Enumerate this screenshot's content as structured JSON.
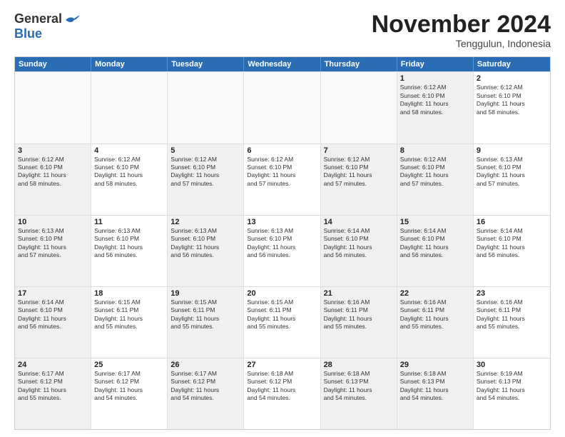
{
  "header": {
    "logo_line1": "General",
    "logo_line2": "Blue",
    "month_title": "November 2024",
    "subtitle": "Tenggulun, Indonesia"
  },
  "weekdays": [
    "Sunday",
    "Monday",
    "Tuesday",
    "Wednesday",
    "Thursday",
    "Friday",
    "Saturday"
  ],
  "rows": [
    [
      {
        "day": "",
        "info": "",
        "empty": true
      },
      {
        "day": "",
        "info": "",
        "empty": true
      },
      {
        "day": "",
        "info": "",
        "empty": true
      },
      {
        "day": "",
        "info": "",
        "empty": true
      },
      {
        "day": "",
        "info": "",
        "empty": true
      },
      {
        "day": "1",
        "info": "Sunrise: 6:12 AM\nSunset: 6:10 PM\nDaylight: 11 hours\nand 58 minutes.",
        "shaded": true
      },
      {
        "day": "2",
        "info": "Sunrise: 6:12 AM\nSunset: 6:10 PM\nDaylight: 11 hours\nand 58 minutes.",
        "shaded": false
      }
    ],
    [
      {
        "day": "3",
        "info": "Sunrise: 6:12 AM\nSunset: 6:10 PM\nDaylight: 11 hours\nand 58 minutes.",
        "shaded": true
      },
      {
        "day": "4",
        "info": "Sunrise: 6:12 AM\nSunset: 6:10 PM\nDaylight: 11 hours\nand 58 minutes.",
        "shaded": false
      },
      {
        "day": "5",
        "info": "Sunrise: 6:12 AM\nSunset: 6:10 PM\nDaylight: 11 hours\nand 57 minutes.",
        "shaded": true
      },
      {
        "day": "6",
        "info": "Sunrise: 6:12 AM\nSunset: 6:10 PM\nDaylight: 11 hours\nand 57 minutes.",
        "shaded": false
      },
      {
        "day": "7",
        "info": "Sunrise: 6:12 AM\nSunset: 6:10 PM\nDaylight: 11 hours\nand 57 minutes.",
        "shaded": true
      },
      {
        "day": "8",
        "info": "Sunrise: 6:12 AM\nSunset: 6:10 PM\nDaylight: 11 hours\nand 57 minutes.",
        "shaded": true
      },
      {
        "day": "9",
        "info": "Sunrise: 6:13 AM\nSunset: 6:10 PM\nDaylight: 11 hours\nand 57 minutes.",
        "shaded": false
      }
    ],
    [
      {
        "day": "10",
        "info": "Sunrise: 6:13 AM\nSunset: 6:10 PM\nDaylight: 11 hours\nand 57 minutes.",
        "shaded": true
      },
      {
        "day": "11",
        "info": "Sunrise: 6:13 AM\nSunset: 6:10 PM\nDaylight: 11 hours\nand 56 minutes.",
        "shaded": false
      },
      {
        "day": "12",
        "info": "Sunrise: 6:13 AM\nSunset: 6:10 PM\nDaylight: 11 hours\nand 56 minutes.",
        "shaded": true
      },
      {
        "day": "13",
        "info": "Sunrise: 6:13 AM\nSunset: 6:10 PM\nDaylight: 11 hours\nand 56 minutes.",
        "shaded": false
      },
      {
        "day": "14",
        "info": "Sunrise: 6:14 AM\nSunset: 6:10 PM\nDaylight: 11 hours\nand 56 minutes.",
        "shaded": true
      },
      {
        "day": "15",
        "info": "Sunrise: 6:14 AM\nSunset: 6:10 PM\nDaylight: 11 hours\nand 56 minutes.",
        "shaded": true
      },
      {
        "day": "16",
        "info": "Sunrise: 6:14 AM\nSunset: 6:10 PM\nDaylight: 11 hours\nand 56 minutes.",
        "shaded": false
      }
    ],
    [
      {
        "day": "17",
        "info": "Sunrise: 6:14 AM\nSunset: 6:10 PM\nDaylight: 11 hours\nand 56 minutes.",
        "shaded": true
      },
      {
        "day": "18",
        "info": "Sunrise: 6:15 AM\nSunset: 6:11 PM\nDaylight: 11 hours\nand 55 minutes.",
        "shaded": false
      },
      {
        "day": "19",
        "info": "Sunrise: 6:15 AM\nSunset: 6:11 PM\nDaylight: 11 hours\nand 55 minutes.",
        "shaded": true
      },
      {
        "day": "20",
        "info": "Sunrise: 6:15 AM\nSunset: 6:11 PM\nDaylight: 11 hours\nand 55 minutes.",
        "shaded": false
      },
      {
        "day": "21",
        "info": "Sunrise: 6:16 AM\nSunset: 6:11 PM\nDaylight: 11 hours\nand 55 minutes.",
        "shaded": true
      },
      {
        "day": "22",
        "info": "Sunrise: 6:16 AM\nSunset: 6:11 PM\nDaylight: 11 hours\nand 55 minutes.",
        "shaded": true
      },
      {
        "day": "23",
        "info": "Sunrise: 6:16 AM\nSunset: 6:11 PM\nDaylight: 11 hours\nand 55 minutes.",
        "shaded": false
      }
    ],
    [
      {
        "day": "24",
        "info": "Sunrise: 6:17 AM\nSunset: 6:12 PM\nDaylight: 11 hours\nand 55 minutes.",
        "shaded": true
      },
      {
        "day": "25",
        "info": "Sunrise: 6:17 AM\nSunset: 6:12 PM\nDaylight: 11 hours\nand 54 minutes.",
        "shaded": false
      },
      {
        "day": "26",
        "info": "Sunrise: 6:17 AM\nSunset: 6:12 PM\nDaylight: 11 hours\nand 54 minutes.",
        "shaded": true
      },
      {
        "day": "27",
        "info": "Sunrise: 6:18 AM\nSunset: 6:12 PM\nDaylight: 11 hours\nand 54 minutes.",
        "shaded": false
      },
      {
        "day": "28",
        "info": "Sunrise: 6:18 AM\nSunset: 6:13 PM\nDaylight: 11 hours\nand 54 minutes.",
        "shaded": true
      },
      {
        "day": "29",
        "info": "Sunrise: 6:18 AM\nSunset: 6:13 PM\nDaylight: 11 hours\nand 54 minutes.",
        "shaded": true
      },
      {
        "day": "30",
        "info": "Sunrise: 6:19 AM\nSunset: 6:13 PM\nDaylight: 11 hours\nand 54 minutes.",
        "shaded": false
      }
    ]
  ]
}
